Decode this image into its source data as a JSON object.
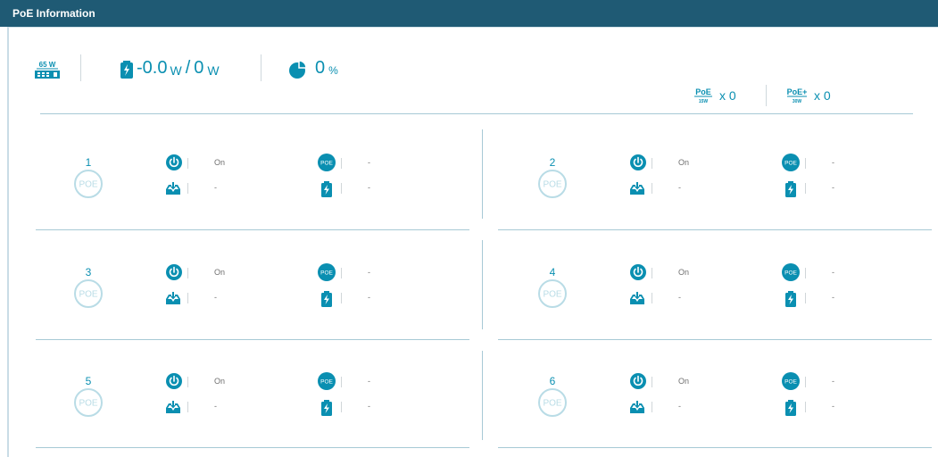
{
  "title": "PoE Information",
  "summary": {
    "budget_label": "65 W",
    "usage_current": "-0.0",
    "usage_unit1": "W",
    "usage_slash": "/",
    "usage_total": "0",
    "usage_unit2": "W",
    "percent_value": "0",
    "percent_unit": "%",
    "poe_class": {
      "label": "PoE",
      "sub": "15W",
      "count": "x 0"
    },
    "poeplus_class": {
      "label": "PoE+",
      "sub": "30W",
      "count": "x 0"
    }
  },
  "ports": [
    {
      "number": "1",
      "power_status": "On",
      "poe_status": "-",
      "class": "-",
      "consumption": "-"
    },
    {
      "number": "2",
      "power_status": "On",
      "poe_status": "-",
      "class": "-",
      "consumption": "-"
    },
    {
      "number": "3",
      "power_status": "On",
      "poe_status": "-",
      "class": "-",
      "consumption": "-"
    },
    {
      "number": "4",
      "power_status": "On",
      "poe_status": "-",
      "class": "-",
      "consumption": "-"
    },
    {
      "number": "5",
      "power_status": "On",
      "poe_status": "-",
      "class": "-",
      "consumption": "-"
    },
    {
      "number": "6",
      "power_status": "On",
      "poe_status": "-",
      "class": "-",
      "consumption": "-"
    }
  ],
  "poe_badge_text": "POE",
  "colors": {
    "accent": "#0a8fb1",
    "titlebar": "#1f5a74",
    "circle": "#b9dce6"
  }
}
